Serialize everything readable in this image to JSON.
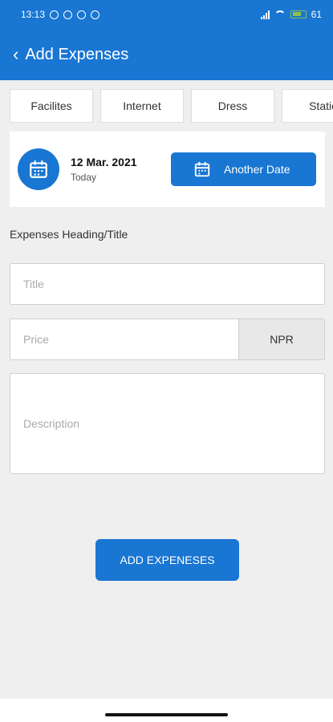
{
  "status_bar": {
    "time": "13:13",
    "battery": "61"
  },
  "app_bar": {
    "title": "Add Expenses",
    "back_icon": "chevron-left-icon"
  },
  "categories": [
    "Facilites",
    "Internet",
    "Dress",
    "Statio"
  ],
  "date_card": {
    "date": "12 Mar. 2021",
    "sub": "Today",
    "another_date_label": "Another Date"
  },
  "form": {
    "section_label": "Expenses Heading/Title",
    "title_placeholder": "Title",
    "price_placeholder": "Price",
    "currency": "NPR",
    "description_placeholder": "Description"
  },
  "actions": {
    "add_label": "ADD EXPENESES"
  },
  "colors": {
    "primary": "#1976d2",
    "background": "#efefef"
  }
}
